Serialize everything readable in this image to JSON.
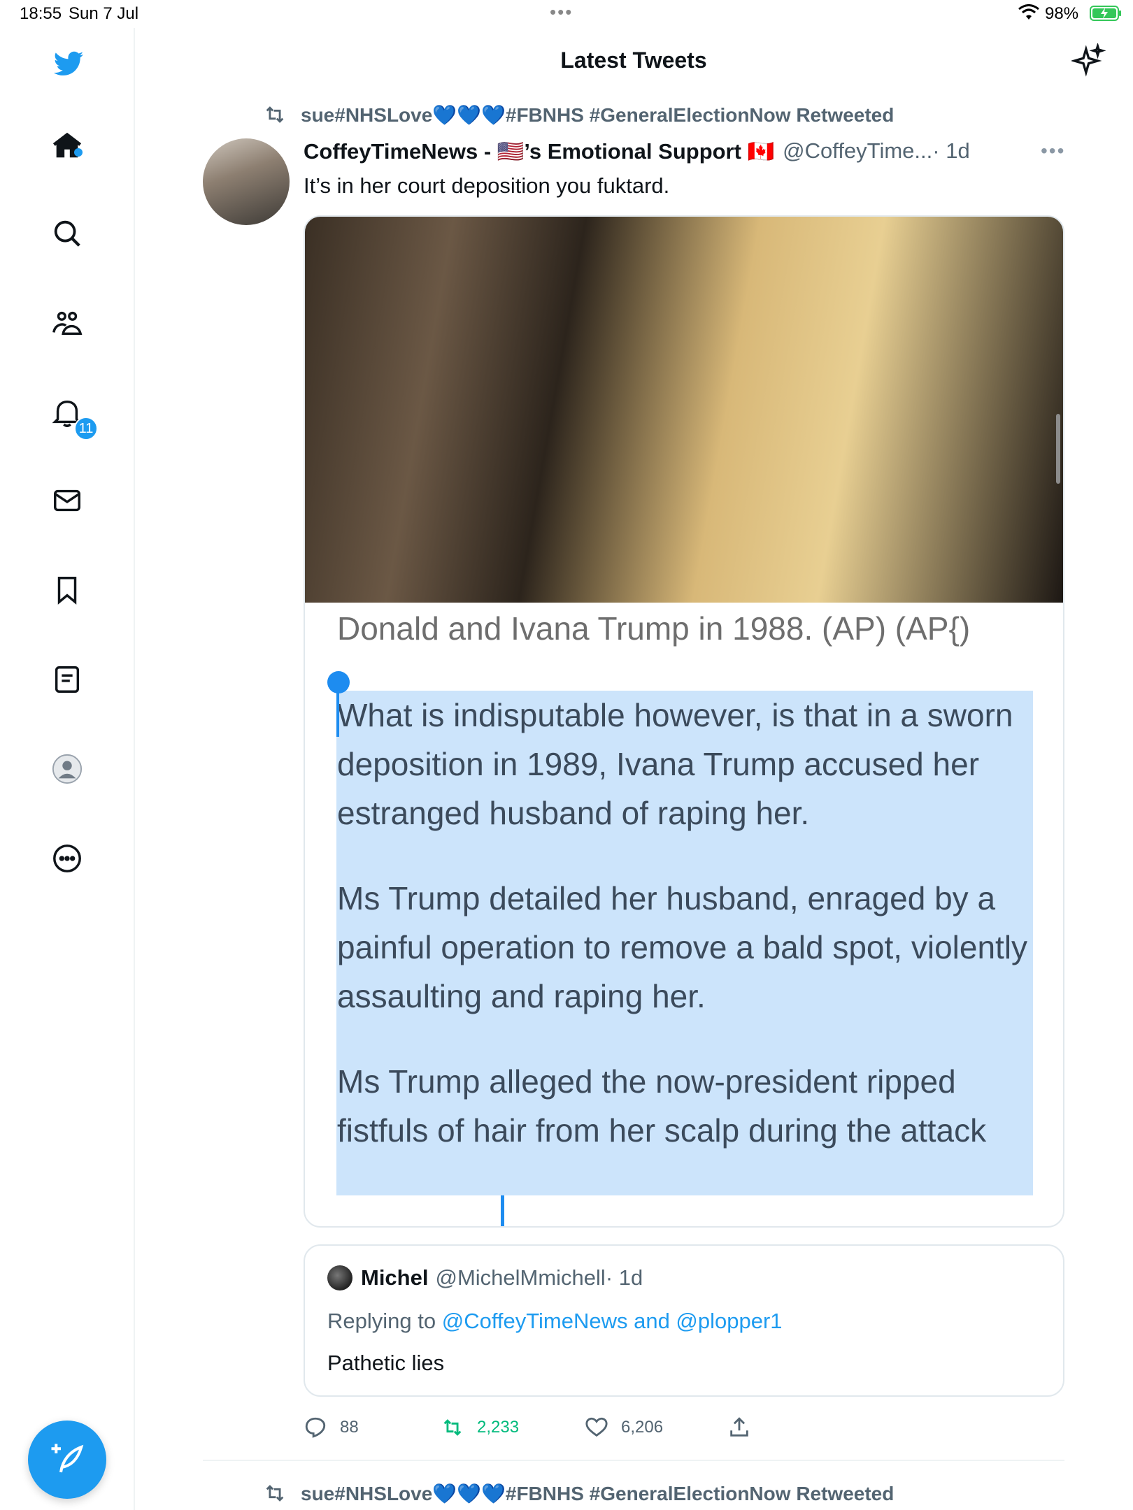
{
  "status_bar": {
    "time": "18:55",
    "date": "Sun 7 Jul",
    "battery": "98%"
  },
  "header": {
    "title": "Latest Tweets"
  },
  "sidebar": {
    "items": [
      {
        "icon": "home-icon"
      },
      {
        "icon": "search-icon"
      },
      {
        "icon": "communities-icon"
      },
      {
        "icon": "notifications-icon"
      },
      {
        "icon": "messages-icon"
      },
      {
        "icon": "bookmarks-icon"
      },
      {
        "icon": "lists-icon"
      },
      {
        "icon": "profile-icon"
      },
      {
        "icon": "more-icon"
      }
    ],
    "notifications_badge": "11"
  },
  "tweet": {
    "retweeted_by": "sue#NHSLove💙💙💙#FBNHS #GeneralElectionNow Retweeted",
    "author_name": "CoffeyTimeNews - 🇺🇸’s Emotional Support 🇨🇦",
    "author_handle": "@CoffeyTime...",
    "time": " · 1d",
    "text": "It’s in her court deposition you fuktard.",
    "image_caption": "Donald and Ivana Trump in 1988. (AP) (AP{)",
    "article_paragraphs": [
      "What is indisputable however, is that in a sworn deposition in 1989, Ivana Trump accused her estranged husband of raping her.",
      "Ms Trump detailed her husband, enraged by a painful operation to remove a bald spot, violently assaulting and raping her.",
      "Ms Trump alleged the now-president ripped fistfuls of hair from her scalp during the attack"
    ],
    "quote": {
      "name": "Michel",
      "handle": "@MichelMmichell",
      "time": " · 1d",
      "replying_prefix": "Replying to ",
      "replying_to": "@CoffeyTimeNews and @plopper1",
      "text": "Pathetic lies"
    },
    "actions": {
      "replies": "88",
      "retweets": "2,233",
      "likes": "6,206"
    }
  },
  "next_tweet": {
    "retweeted_by": "sue#NHSLove💙💙💙#FBNHS #GeneralElectionNow Retweeted"
  },
  "colors": {
    "accent": "#1d9bf0",
    "retweet_green": "#00ba7c",
    "selection": "#cce4fb"
  }
}
